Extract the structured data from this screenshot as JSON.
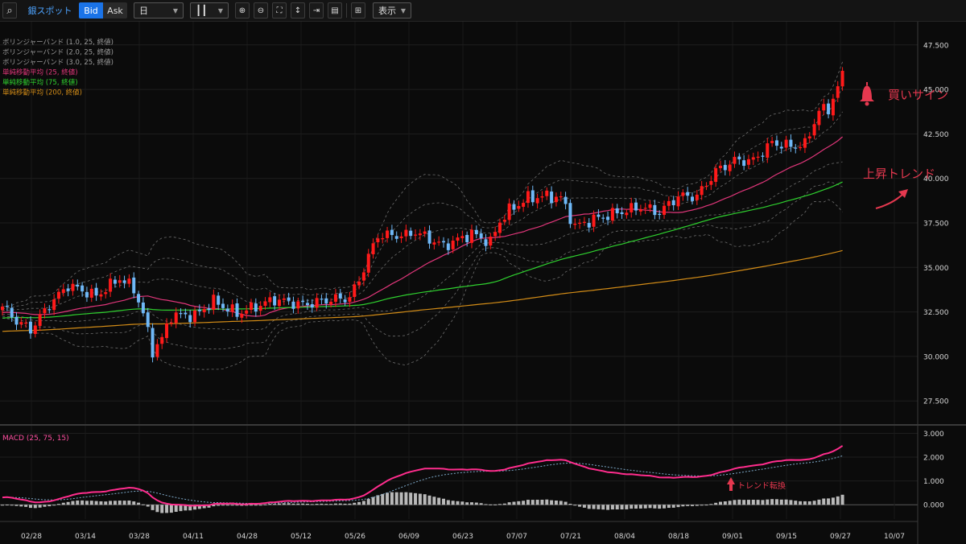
{
  "toolbar": {
    "symbol": "銀スポット",
    "bid_label": "Bid",
    "ask_label": "Ask",
    "period": "日",
    "display_label": "表示"
  },
  "legend": [
    {
      "label": "ボリンジャーバンド (1.0, 25, 終値)",
      "color": "#9a9a9a"
    },
    {
      "label": "ボリンジャーバンド (2.0, 25, 終値)",
      "color": "#9a9a9a"
    },
    {
      "label": "ボリンジャーバンド (3.0, 25, 終値)",
      "color": "#9a9a9a"
    },
    {
      "label": "単純移動平均 (25, 終値)",
      "color": "#e0367a"
    },
    {
      "label": "単純移動平均 (75, 終値)",
      "color": "#2fd12f"
    },
    {
      "label": "単純移動平均 (200, 終値)",
      "color": "#d38c17"
    }
  ],
  "annotations": {
    "buy_signal": "買いサイン",
    "uptrend": "上昇トレンド",
    "trend_reversal": "トレンド転換"
  },
  "macd_label": "MACD (25, 75, 15)",
  "colors": {
    "up": "#ff1a1a",
    "down": "#6fb8f7",
    "accent": "#e5384f",
    "bid": "#1a73e8"
  },
  "chart_data": {
    "type": "candlestick",
    "x_tick_labels": [
      "02/28",
      "03/14",
      "03/28",
      "04/11",
      "04/28",
      "05/12",
      "05/26",
      "06/09",
      "06/23",
      "07/07",
      "07/21",
      "08/04",
      "08/18",
      "09/01",
      "09/15",
      "09/27",
      "10/07"
    ],
    "price_axis": {
      "ticks": [
        27500,
        30000,
        32500,
        35000,
        37500,
        40000,
        42500,
        45000,
        47500
      ],
      "tick_labels": [
        "27.500",
        "30.000",
        "32.500",
        "35.000",
        "37.500",
        "40.000",
        "42.500",
        "45.000",
        "47.500"
      ],
      "ylim": [
        26200,
        48800
      ]
    },
    "macd_axis": {
      "ticks": [
        0,
        1000,
        2000,
        3000
      ],
      "tick_labels": [
        "0.000",
        "1.000",
        "2.000",
        "3.000"
      ],
      "ylim": [
        -600,
        3150
      ]
    },
    "close_anchors": [
      [
        0,
        32800
      ],
      [
        3,
        32000
      ],
      [
        6,
        31500
      ],
      [
        10,
        32900
      ],
      [
        14,
        34000
      ],
      [
        20,
        33400
      ],
      [
        25,
        34400
      ],
      [
        28,
        33800
      ],
      [
        30,
        32400
      ],
      [
        32,
        30300
      ],
      [
        34,
        31000
      ],
      [
        36,
        32300
      ],
      [
        41,
        32300
      ],
      [
        45,
        33100
      ],
      [
        50,
        32400
      ],
      [
        58,
        33200
      ],
      [
        64,
        32900
      ],
      [
        70,
        33200
      ],
      [
        74,
        33300
      ],
      [
        76,
        34300
      ],
      [
        78,
        35600
      ],
      [
        80,
        36800
      ],
      [
        86,
        36800
      ],
      [
        88,
        37000
      ],
      [
        94,
        36200
      ],
      [
        100,
        36900
      ],
      [
        104,
        36400
      ],
      [
        106,
        37600
      ],
      [
        108,
        38200
      ],
      [
        112,
        38900
      ],
      [
        116,
        39000
      ],
      [
        119,
        38900
      ],
      [
        122,
        37300
      ],
      [
        126,
        37700
      ],
      [
        130,
        38000
      ],
      [
        136,
        38400
      ],
      [
        140,
        38100
      ],
      [
        144,
        39000
      ],
      [
        148,
        39000
      ],
      [
        152,
        40400
      ],
      [
        156,
        41000
      ],
      [
        160,
        41000
      ],
      [
        164,
        42000
      ],
      [
        168,
        41800
      ],
      [
        171,
        41900
      ],
      [
        174,
        43800
      ],
      [
        176,
        43900
      ],
      [
        178,
        45100
      ],
      [
        179,
        45800
      ]
    ]
  }
}
